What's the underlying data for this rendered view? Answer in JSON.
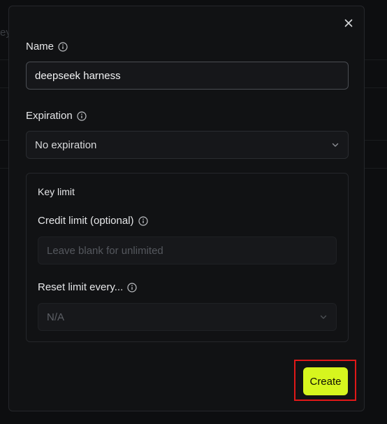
{
  "background": {
    "fragment_text": "ey"
  },
  "dialog": {
    "close_icon": "close-icon",
    "name": {
      "label": "Name",
      "value": "deepseek harness",
      "info_icon": "info-icon"
    },
    "expiration": {
      "label": "Expiration",
      "selected": "No expiration",
      "info_icon": "info-icon",
      "chevron_icon": "chevron-down-icon"
    },
    "key_limit": {
      "title": "Key limit",
      "credit_limit": {
        "label": "Credit limit (optional)",
        "placeholder": "Leave blank for unlimited",
        "info_icon": "info-icon"
      },
      "reset_limit": {
        "label": "Reset limit every...",
        "selected": "N/A",
        "info_icon": "info-icon",
        "chevron_icon": "chevron-down-icon"
      }
    },
    "create_button": {
      "label": "Create"
    }
  },
  "colors": {
    "accent": "#d6f51e",
    "highlight": "#e01818",
    "dialog_bg": "#111214"
  }
}
